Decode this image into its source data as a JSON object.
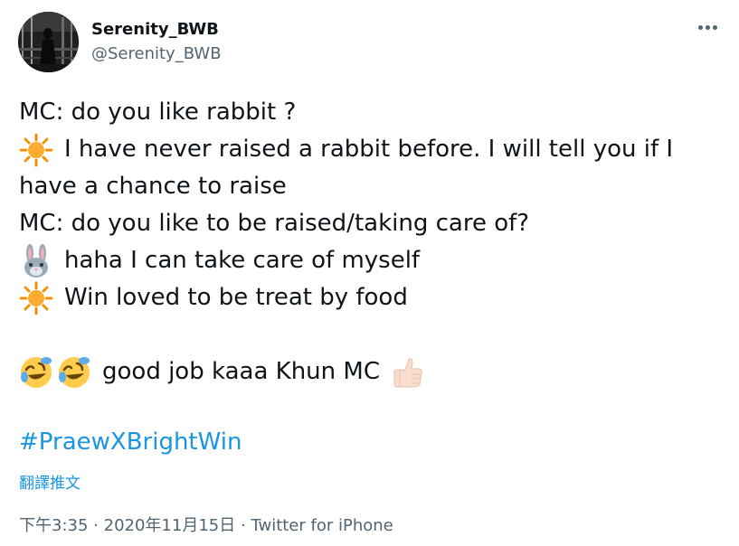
{
  "author": {
    "display_name": "Serenity_BWB",
    "handle": "@Serenity_BWB"
  },
  "more_icon": "more-horizontal-icon",
  "tweet": {
    "lines": [
      {
        "emoji": null,
        "text": "MC: do you like rabbit ?"
      },
      {
        "emoji": "sun",
        "text": "I have never raised a rabbit before. I will tell you if I"
      },
      {
        "emoji": null,
        "text": "have a chance to raise"
      },
      {
        "emoji": null,
        "text": "MC: do you like to be raised/taking care of?"
      },
      {
        "emoji": "rabbit-face",
        "text": "haha I can take care of myself"
      },
      {
        "emoji": "sun",
        "text": "Win loved to be treat by food"
      },
      {
        "emoji": null,
        "text": ""
      },
      {
        "emoji": "rolling-on-floor-laughing x2",
        "text": "good job kaaa Khun MC",
        "trailing_emoji": "thumbs-up"
      }
    ]
  },
  "hashtag": "#PraewXBrightWin",
  "translate_label": "翻譯推文",
  "meta": {
    "time": "下午3:35",
    "separator": "·",
    "date": "2020年11月15日",
    "source": "Twitter for iPhone"
  },
  "colors": {
    "text": "#0f1419",
    "secondary": "#536471",
    "link": "#1b95e0"
  }
}
